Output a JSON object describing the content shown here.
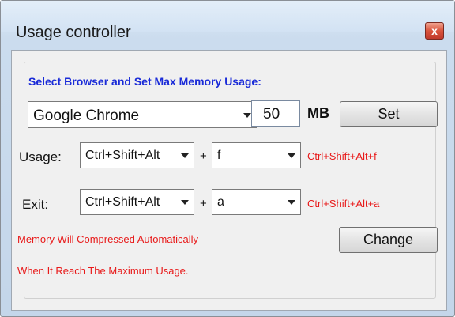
{
  "window": {
    "title": "Usage controller",
    "close_label": "x"
  },
  "panel": {
    "heading": "Select Browser and Set Max Memory Usage:"
  },
  "browser_row": {
    "browser_select": "Google Chrome",
    "memory_value": "50",
    "unit": "MB",
    "set_label": "Set"
  },
  "usage_row": {
    "label": "Usage:",
    "modifier_select": "Ctrl+Shift+Alt",
    "plus": "+",
    "key_select": "f",
    "hotkey_text": "Ctrl+Shift+Alt+f"
  },
  "exit_row": {
    "label": "Exit:",
    "modifier_select": "Ctrl+Shift+Alt",
    "plus": "+",
    "key_select": "a",
    "hotkey_text": "Ctrl+Shift+Alt+a"
  },
  "notes": {
    "line1": "Memory Will Compressed Automatically",
    "line2": "When It Reach The Maximum Usage."
  },
  "change_label": "Change",
  "colors": {
    "heading": "#1a2bd8",
    "notice": "#e81a1a"
  }
}
